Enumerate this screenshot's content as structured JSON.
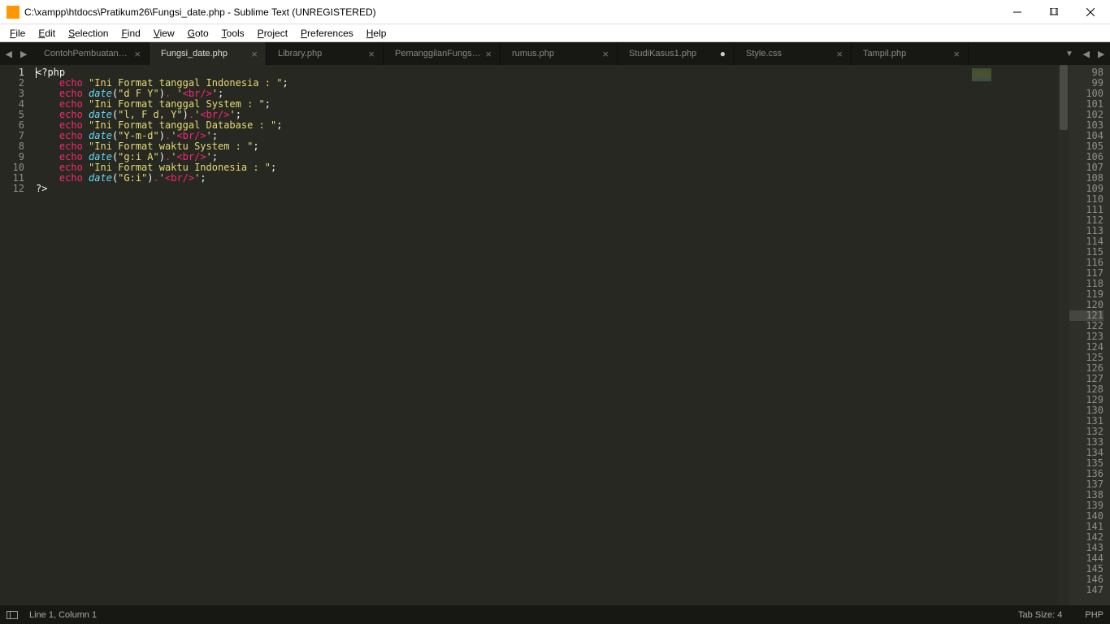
{
  "window": {
    "title": "C:\\xampp\\htdocs\\Pratikum26\\Fungsi_date.php - Sublime Text (UNREGISTERED)"
  },
  "menu": [
    "File",
    "Edit",
    "Selection",
    "Find",
    "View",
    "Goto",
    "Tools",
    "Project",
    "Preferences",
    "Help"
  ],
  "tabs": [
    {
      "label": "ContohPembuatanFungsi.php",
      "active": false,
      "dirty": false
    },
    {
      "label": "Fungsi_date.php",
      "active": true,
      "dirty": false
    },
    {
      "label": "Library.php",
      "active": false,
      "dirty": false
    },
    {
      "label": "PemanggilanFungsi.php",
      "active": false,
      "dirty": false
    },
    {
      "label": "rumus.php",
      "active": false,
      "dirty": false
    },
    {
      "label": "StudiKasus1.php",
      "active": false,
      "dirty": true
    },
    {
      "label": "Style.css",
      "active": false,
      "dirty": false
    },
    {
      "label": "Tampil.php",
      "active": false,
      "dirty": false
    }
  ],
  "left_lines_start": 1,
  "left_lines_end": 12,
  "right_lines_start": 98,
  "right_lines_end": 147,
  "right_highlight": 121,
  "code": [
    {
      "tokens": [
        {
          "t": "plain",
          "v": "<?php"
        }
      ]
    },
    {
      "tokens": [
        {
          "t": "kw",
          "v": "    echo "
        },
        {
          "t": "str",
          "v": "\"Ini Format tanggal Indonesia : \""
        },
        {
          "t": "punct",
          "v": ";"
        }
      ]
    },
    {
      "tokens": [
        {
          "t": "kw",
          "v": "    echo "
        },
        {
          "t": "fn",
          "v": "date"
        },
        {
          "t": "punct",
          "v": "("
        },
        {
          "t": "str",
          "v": "\"d F Y\""
        },
        {
          "t": "punct",
          "v": ")"
        },
        {
          "t": "op",
          "v": ". "
        },
        {
          "t": "str",
          "v": "'"
        },
        {
          "t": "tag",
          "v": "<br/>"
        },
        {
          "t": "str",
          "v": "'"
        },
        {
          "t": "punct",
          "v": ";"
        }
      ]
    },
    {
      "tokens": [
        {
          "t": "kw",
          "v": "    echo "
        },
        {
          "t": "str",
          "v": "\"Ini Format tanggal System : \""
        },
        {
          "t": "punct",
          "v": ";"
        }
      ]
    },
    {
      "tokens": [
        {
          "t": "kw",
          "v": "    echo "
        },
        {
          "t": "fn",
          "v": "date"
        },
        {
          "t": "punct",
          "v": "("
        },
        {
          "t": "str",
          "v": "\"l, F d, Y\""
        },
        {
          "t": "punct",
          "v": ")"
        },
        {
          "t": "op",
          "v": "."
        },
        {
          "t": "str",
          "v": "'"
        },
        {
          "t": "tag",
          "v": "<br/>"
        },
        {
          "t": "str",
          "v": "'"
        },
        {
          "t": "punct",
          "v": ";"
        }
      ]
    },
    {
      "tokens": [
        {
          "t": "kw",
          "v": "    echo "
        },
        {
          "t": "str",
          "v": "\"Ini Format tanggal Database : \""
        },
        {
          "t": "punct",
          "v": ";"
        }
      ]
    },
    {
      "tokens": [
        {
          "t": "kw",
          "v": "    echo "
        },
        {
          "t": "fn",
          "v": "date"
        },
        {
          "t": "punct",
          "v": "("
        },
        {
          "t": "str",
          "v": "\"Y-m-d\""
        },
        {
          "t": "punct",
          "v": ")"
        },
        {
          "t": "op",
          "v": "."
        },
        {
          "t": "str",
          "v": "'"
        },
        {
          "t": "tag",
          "v": "<br/>"
        },
        {
          "t": "str",
          "v": "'"
        },
        {
          "t": "punct",
          "v": ";"
        }
      ]
    },
    {
      "tokens": [
        {
          "t": "kw",
          "v": "    echo "
        },
        {
          "t": "str",
          "v": "\"Ini Format waktu System : \""
        },
        {
          "t": "punct",
          "v": ";"
        }
      ]
    },
    {
      "tokens": [
        {
          "t": "kw",
          "v": "    echo "
        },
        {
          "t": "fn",
          "v": "date"
        },
        {
          "t": "punct",
          "v": "("
        },
        {
          "t": "str",
          "v": "\"g:i A\""
        },
        {
          "t": "punct",
          "v": ")"
        },
        {
          "t": "op",
          "v": "."
        },
        {
          "t": "str",
          "v": "'"
        },
        {
          "t": "tag",
          "v": "<br/>"
        },
        {
          "t": "str",
          "v": "'"
        },
        {
          "t": "punct",
          "v": ";"
        }
      ]
    },
    {
      "tokens": [
        {
          "t": "kw",
          "v": "    echo "
        },
        {
          "t": "str",
          "v": "\"Ini Format waktu Indonesia : \""
        },
        {
          "t": "punct",
          "v": ";"
        }
      ]
    },
    {
      "tokens": [
        {
          "t": "kw",
          "v": "    echo "
        },
        {
          "t": "fn",
          "v": "date"
        },
        {
          "t": "punct",
          "v": "("
        },
        {
          "t": "str",
          "v": "\"G:i\""
        },
        {
          "t": "punct",
          "v": ")"
        },
        {
          "t": "op",
          "v": "."
        },
        {
          "t": "str",
          "v": "'"
        },
        {
          "t": "tag",
          "v": "<br/>"
        },
        {
          "t": "str",
          "v": "'"
        },
        {
          "t": "punct",
          "v": ";"
        }
      ]
    },
    {
      "tokens": [
        {
          "t": "plain",
          "v": "?>"
        }
      ]
    }
  ],
  "status": {
    "linecol": "Line 1, Column 1",
    "tabsize": "Tab Size: 4",
    "syntax": "PHP"
  }
}
